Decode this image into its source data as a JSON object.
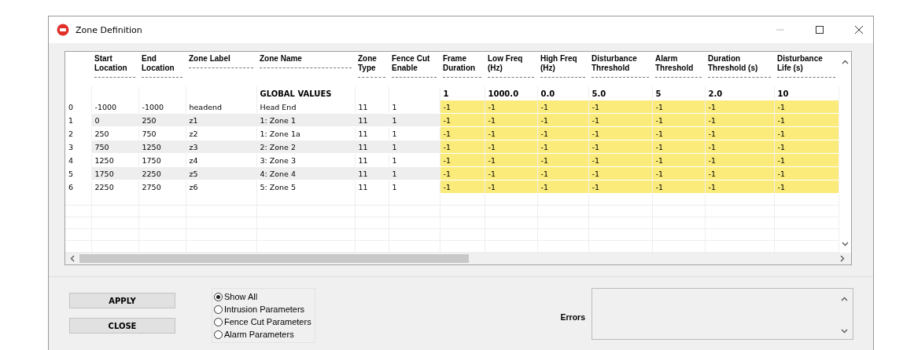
{
  "window": {
    "title": "Zone Definition"
  },
  "table": {
    "columns": [
      {},
      {
        "label": "Start Location",
        "highlighted": false
      },
      {
        "label": "End Location",
        "highlighted": false
      },
      {
        "label": "Zone Label",
        "highlighted": false
      },
      {
        "label": "Zone Name",
        "highlighted": false,
        "global_value": "GLOBAL VALUES"
      },
      {
        "label": "Zone Type",
        "highlighted": false
      },
      {
        "label": "Fence Cut Enable",
        "highlighted": false
      },
      {
        "label": "Frame Duration",
        "highlighted": true,
        "global_value": "1"
      },
      {
        "label": "Low Freq (Hz)",
        "highlighted": true,
        "global_value": "1000.0"
      },
      {
        "label": "High Freq (Hz)",
        "highlighted": true,
        "global_value": "0.0"
      },
      {
        "label": "Disturbance Threshold",
        "highlighted": true,
        "global_value": "5.0"
      },
      {
        "label": "Alarm Threshold",
        "highlighted": true,
        "global_value": "5"
      },
      {
        "label": "Duration Threshold (s)",
        "highlighted": true,
        "global_value": "2.0"
      },
      {
        "label": "Disturbance Life (s)",
        "highlighted": true,
        "global_value": "10"
      }
    ],
    "rows": [
      [
        "0",
        "-1000",
        "-1000",
        "headend",
        "Head End",
        "11",
        "1",
        "-1",
        "-1",
        "-1",
        "-1",
        "-1",
        "-1",
        "-1"
      ],
      [
        "1",
        "0",
        "250",
        "z1",
        "1: Zone 1",
        "11",
        "1",
        "-1",
        "-1",
        "-1",
        "-1",
        "-1",
        "-1",
        "-1"
      ],
      [
        "2",
        "250",
        "750",
        "z2",
        "1: Zone 1a",
        "11",
        "1",
        "-1",
        "-1",
        "-1",
        "-1",
        "-1",
        "-1",
        "-1"
      ],
      [
        "3",
        "750",
        "1250",
        "z3",
        "2: Zone 2",
        "11",
        "1",
        "-1",
        "-1",
        "-1",
        "-1",
        "-1",
        "-1",
        "-1"
      ],
      [
        "4",
        "1250",
        "1750",
        "z4",
        "3: Zone 3",
        "11",
        "1",
        "-1",
        "-1",
        "-1",
        "-1",
        "-1",
        "-1",
        "-1"
      ],
      [
        "5",
        "1750",
        "2250",
        "z5",
        "4: Zone 4",
        "11",
        "1",
        "-1",
        "-1",
        "-1",
        "-1",
        "-1",
        "-1",
        "-1"
      ],
      [
        "6",
        "2250",
        "2750",
        "z6",
        "5: Zone 5",
        "11",
        "1",
        "-1",
        "-1",
        "-1",
        "-1",
        "-1",
        "-1",
        "-1"
      ]
    ]
  },
  "buttons": [
    "APPLY",
    "CLOSE"
  ],
  "filter": [
    {
      "label": "Show All",
      "selected": true
    },
    {
      "label": "Intrusion Parameters",
      "selected": false
    },
    {
      "label": "Fence Cut Parameters",
      "selected": false
    },
    {
      "label": "Alarm Parameters",
      "selected": false
    }
  ],
  "errors": {
    "label": "Errors"
  }
}
